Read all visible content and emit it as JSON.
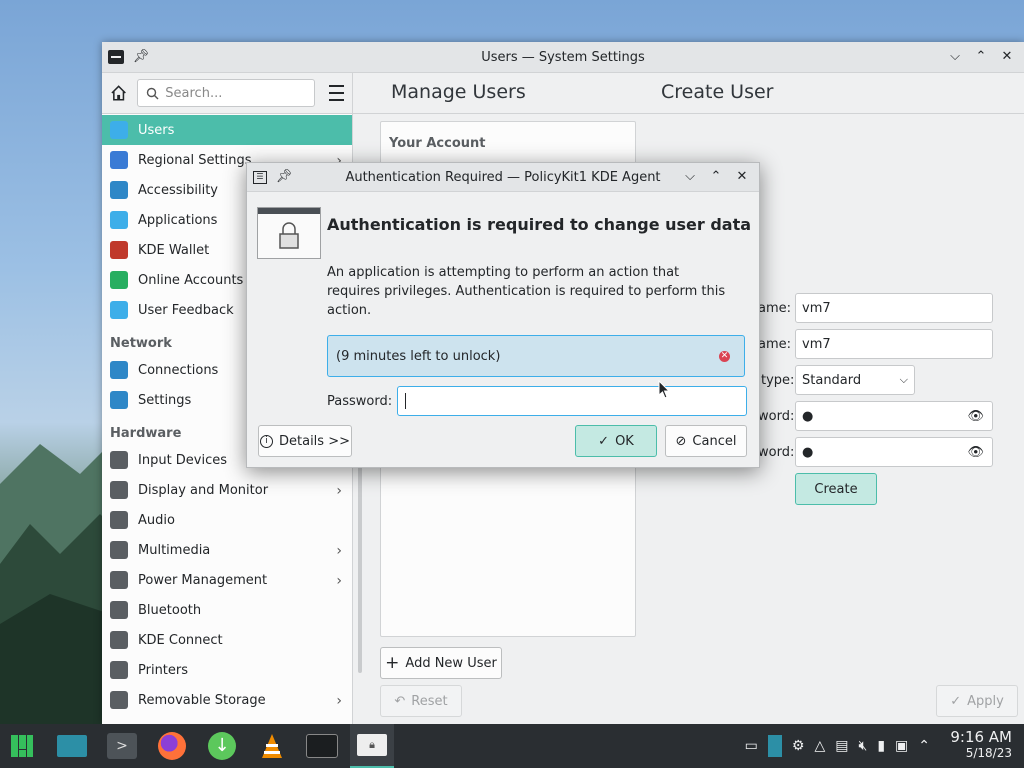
{
  "window": {
    "title": "Users — System Settings",
    "search_placeholder": "Search...",
    "header_left": "Manage Users",
    "header_right": "Create User"
  },
  "sidebar": {
    "items": [
      {
        "label": "Users",
        "selected": true,
        "icon": "users-icon",
        "color": "#3daee9"
      },
      {
        "label": "Regional Settings",
        "chevron": true,
        "icon": "regional-icon",
        "color": "#3a7bd5"
      },
      {
        "label": "Accessibility",
        "icon": "accessibility-icon",
        "color": "#2e87c7"
      },
      {
        "label": "Applications",
        "icon": "applications-icon",
        "color": "#3daee9"
      },
      {
        "label": "KDE Wallet",
        "icon": "wallet-icon",
        "color": "#c0392b"
      },
      {
        "label": "Online Accounts",
        "icon": "online-accounts-icon",
        "color": "#27ae60"
      },
      {
        "label": "User Feedback",
        "icon": "feedback-icon",
        "color": "#3daee9"
      }
    ],
    "network_label": "Network",
    "network_items": [
      {
        "label": "Connections",
        "icon": "globe-icon"
      },
      {
        "label": "Settings",
        "icon": "globe-icon"
      }
    ],
    "hardware_label": "Hardware",
    "hardware_items": [
      {
        "label": "Input Devices",
        "chevron": false,
        "icon": "mouse-icon"
      },
      {
        "label": "Display and Monitor",
        "chevron": true,
        "icon": "monitor-icon"
      },
      {
        "label": "Audio",
        "chevron": false,
        "icon": "speaker-icon"
      },
      {
        "label": "Multimedia",
        "chevron": true,
        "icon": "multimedia-icon"
      },
      {
        "label": "Power Management",
        "chevron": true,
        "icon": "power-icon"
      },
      {
        "label": "Bluetooth",
        "chevron": false,
        "icon": "bluetooth-icon"
      },
      {
        "label": "KDE Connect",
        "chevron": false,
        "icon": "phone-icon"
      },
      {
        "label": "Printers",
        "chevron": false,
        "icon": "printer-icon"
      },
      {
        "label": "Removable Storage",
        "chevron": true,
        "icon": "usb-icon"
      }
    ]
  },
  "main": {
    "your_account": "Your Account",
    "add_user": "Add New User",
    "reset": "Reset",
    "apply": "Apply",
    "name_label": "ame:",
    "name_value": "vm7",
    "username_label": "ame:",
    "username_value": "vm7",
    "type_label": "type:",
    "type_value": "Standard",
    "password_label": "word:",
    "password_mask": "●",
    "confirm_label": "word:",
    "confirm_mask": "●",
    "create": "Create"
  },
  "dialog": {
    "title": "Authentication Required — PolicyKit1 KDE Agent",
    "heading": "Authentication is required to change user data",
    "description": "An application is attempting to perform an action that requires privileges. Authentication is required to perform this action.",
    "message": "(9 minutes left to unlock)",
    "password_label": "Password:",
    "details": "Details >>",
    "ok": "OK",
    "cancel": "Cancel"
  },
  "taskbar": {
    "time": "9:16 AM",
    "date": "5/18/23"
  },
  "colors": {
    "accent": "#4cbdaa",
    "focus": "#3daee9",
    "error": "#da4453"
  }
}
